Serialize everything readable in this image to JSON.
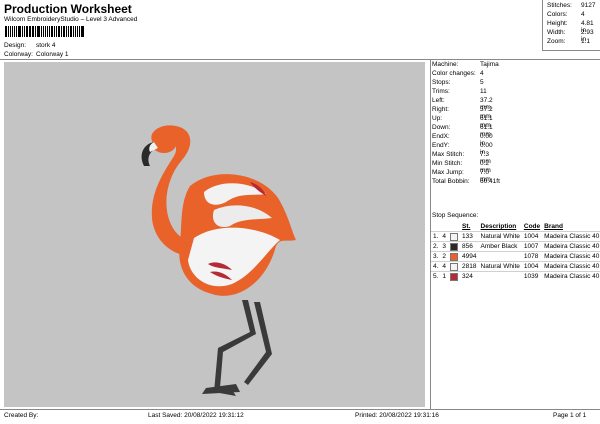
{
  "header": {
    "title": "Production Worksheet",
    "subtitle": "Wilcom EmbroideryStudio – Level 3 Advanced"
  },
  "info": {
    "design_label": "Design:",
    "design_value": "stork 4",
    "colorway_label": "Colorway:",
    "colorway_value": "Colorway 1"
  },
  "stats": [
    {
      "label": "Stitches:",
      "value": "9127"
    },
    {
      "label": "Colors:",
      "value": "4"
    },
    {
      "label": "Height:",
      "value": "4.81 in"
    },
    {
      "label": "Width:",
      "value": "2.93 in"
    },
    {
      "label": "Zoom:",
      "value": "1:1"
    }
  ],
  "machine_info": [
    {
      "label": "Machine:",
      "value": "Tajima"
    },
    {
      "label": "Color changes:",
      "value": "4"
    },
    {
      "label": "Stops:",
      "value": "5"
    },
    {
      "label": "Trims:",
      "value": "11"
    },
    {
      "label": "Left:",
      "value": "37.2 mm"
    },
    {
      "label": "Right:",
      "value": "37.2 mm"
    },
    {
      "label": "Up:",
      "value": "61.1 mm"
    },
    {
      "label": "Down:",
      "value": "61.1 mm"
    },
    {
      "label": "EndX:",
      "value": "0.00 in"
    },
    {
      "label": "EndY:",
      "value": "0.00 in"
    },
    {
      "label": "Max Stitch:",
      "value": "7.3 mm"
    },
    {
      "label": "Min Stitch:",
      "value": "0.2 mm"
    },
    {
      "label": "Max Jump:",
      "value": "7.0 mm"
    },
    {
      "label": "Total Bobbin:",
      "value": "60.41ft"
    }
  ],
  "stop_sequence": {
    "title": "Stop Sequence:",
    "headers": [
      "",
      "",
      "",
      "St.",
      "Description",
      "Code",
      "Brand"
    ],
    "rows": [
      {
        "idx": "1.",
        "n": "4",
        "color": "#f4f4f4",
        "st": "133",
        "desc": "Natural White",
        "code": "1004",
        "brand": "Madeira Classic 40"
      },
      {
        "idx": "2.",
        "n": "3",
        "color": "#2a2a2a",
        "st": "856",
        "desc": "Amber Black",
        "code": "1007",
        "brand": "Madeira Classic 40"
      },
      {
        "idx": "3.",
        "n": "2",
        "color": "#e8622a",
        "st": "4994",
        "desc": "",
        "code": "1078",
        "brand": "Madeira Classic 40"
      },
      {
        "idx": "4.",
        "n": "4",
        "color": "#f4f4f4",
        "st": "2818",
        "desc": "Natural White",
        "code": "1004",
        "brand": "Madeira Classic 40"
      },
      {
        "idx": "5.",
        "n": "1",
        "color": "#b52a35",
        "st": "324",
        "desc": "",
        "code": "1039",
        "brand": "Madeira Classic 40"
      }
    ]
  },
  "footer": {
    "created_by": "Created By:",
    "last_saved": "Last Saved: 20/08/2022 19:31:12",
    "printed": "Printed: 20/08/2022 19:31:16",
    "page": "Page 1 of 1"
  },
  "colors": {
    "canvas": "#c4c4c4",
    "flamingo_orange": "#e8622a",
    "legs": "#3a3a3a"
  }
}
